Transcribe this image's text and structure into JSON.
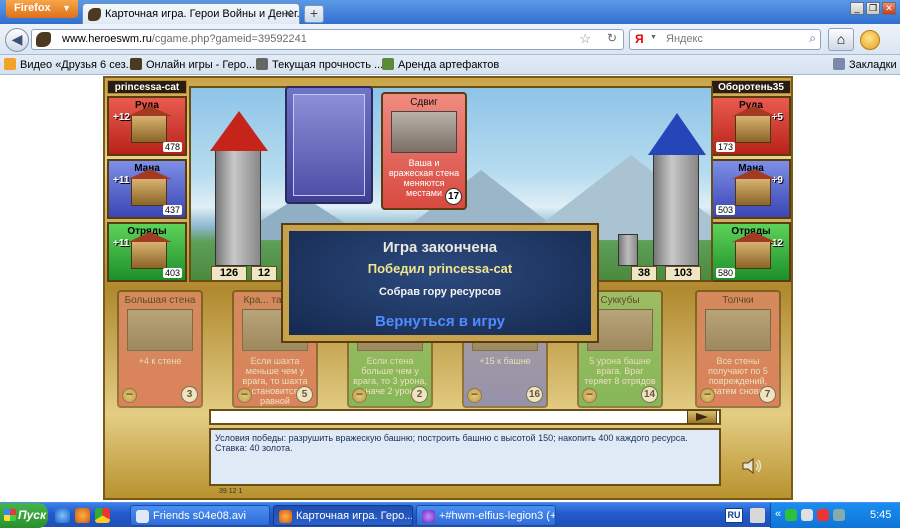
{
  "browser": {
    "app_button": "Firefox",
    "tab_title": "Карточная игра. Герои Войны и Денег.",
    "new_tab": "+",
    "url_host": "www.heroeswm.ru",
    "url_path": "/cgame.php?gameid=39592241",
    "search_placeholder": "Яндекс",
    "search_engine_glyph": "Я",
    "bookmarks": [
      "Видео «Друзья 6 сез...",
      "Онлайн игры - Геро...",
      "Текущая прочность ...",
      "Аренда артефактов"
    ],
    "bookmarks_folder": "Закладки",
    "icons": [
      "back-icon",
      "star-icon",
      "reload-icon",
      "search-icon",
      "home-icon",
      "addon-icon"
    ]
  },
  "game": {
    "left_player": {
      "name": "princessa-cat",
      "resources": [
        {
          "name": "Руда",
          "increment": "+12",
          "amount": "478"
        },
        {
          "name": "Мана",
          "increment": "+11",
          "amount": "437"
        },
        {
          "name": "Отряды",
          "increment": "+11",
          "amount": "403"
        }
      ],
      "tower": "126",
      "wall": "12"
    },
    "right_player": {
      "name": "Оборотень35",
      "resources": [
        {
          "name": "Руда",
          "increment": "+5",
          "amount": "173"
        },
        {
          "name": "Мана",
          "increment": "+9",
          "amount": "503"
        },
        {
          "name": "Отряды",
          "increment": "+12",
          "amount": "580"
        }
      ],
      "wall": "38",
      "tower": "103"
    },
    "played_card": {
      "title": "Сдвиг",
      "text": "Ваша и вражеская стена меняются местами",
      "cost": "17"
    },
    "hand": [
      {
        "title": "Большая стена",
        "text": "+4 к стене",
        "cost": "3",
        "color": "red"
      },
      {
        "title": "Кра... тайна...",
        "text": "Если шахта меньше чем у врага, то шахта становится равной вражеской",
        "cost": "5",
        "color": "red"
      },
      {
        "title": "",
        "text": "Если стена больше чем у врага, то 3 урона, иначе 2 урона",
        "cost": "2",
        "color": "green"
      },
      {
        "title": "",
        "text": "+15 к башне",
        "cost": "16",
        "color": "blue"
      },
      {
        "title": "Суккубы",
        "text": "5 урона башне врага. Враг теряет 8 отрядов",
        "cost": "14",
        "color": "green"
      },
      {
        "title": "Толчки",
        "text": "Все стены получают по 5 повреждений, затем снова",
        "cost": "7",
        "color": "red"
      }
    ],
    "discard_glyph": "−",
    "modal": {
      "title": "Игра закончена",
      "winner": "Победил princessa-cat",
      "reason": "Собрав гору ресурсов",
      "return_link": "Вернуться в игру"
    },
    "log": {
      "victory": "Условия победы: разрушить вражескую башню; построить башню с высотой 150; накопить 400 каждого ресурса.",
      "stake": "Ставка: 40 золота."
    },
    "version": "39 12 1"
  },
  "taskbar": {
    "start": "Пуск",
    "tasks": [
      "Friends s04e08.avi",
      "Карточная игра. Геро...",
      "+#hwm-elfius-legion3 (+..."
    ],
    "lang": "RU",
    "clock": "5:45",
    "tray_arrow": "«"
  }
}
